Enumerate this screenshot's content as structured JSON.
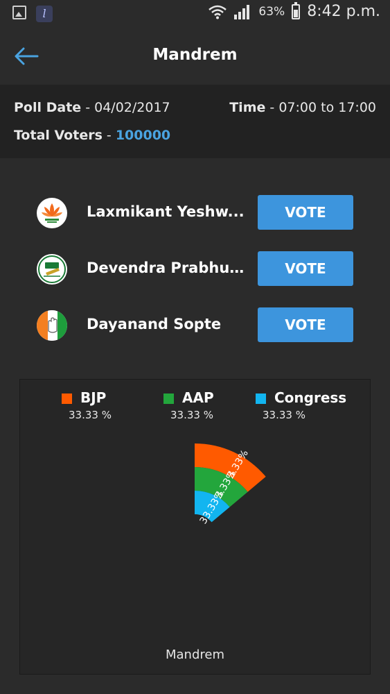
{
  "status_bar": {
    "battery_percent": "63%",
    "time": "8:42 p.m."
  },
  "header": {
    "title": "Mandrem"
  },
  "poll_info": {
    "poll_date_label": "Poll Date",
    "poll_date_value": "04/02/2017",
    "time_label": "Time",
    "time_value": "07:00 to 17:00",
    "total_voters_label": "Total Voters",
    "total_voters_value": "100000",
    "separator": " - "
  },
  "candidates": [
    {
      "name": "Laxmikant Yeshw...",
      "party_icon": "bjp-lotus-icon",
      "vote_label": "VOTE"
    },
    {
      "name": "Devendra Prabhu...",
      "party_icon": "aap-broom-icon",
      "vote_label": "VOTE"
    },
    {
      "name": "Dayanand Sopte",
      "party_icon": "congress-hand-icon",
      "vote_label": "VOTE"
    }
  ],
  "colors": {
    "accent_blue": "#3d95dd",
    "bjp": "#ff5a00",
    "aap": "#23a63c",
    "congress": "#12b5f0"
  },
  "chart_data": {
    "type": "pie",
    "title": "Mandrem",
    "series": [
      {
        "name": "BJP",
        "value": 33.33,
        "label": "33.33 %",
        "slice_label": "33.33%",
        "color": "#ff5a00"
      },
      {
        "name": "AAP",
        "value": 33.33,
        "label": "33.33 %",
        "slice_label": "33.33%",
        "color": "#23a63c"
      },
      {
        "name": "Congress",
        "value": 33.33,
        "label": "33.33 %",
        "slice_label": "33.33%",
        "color": "#12b5f0"
      }
    ],
    "legend_position": "top"
  }
}
